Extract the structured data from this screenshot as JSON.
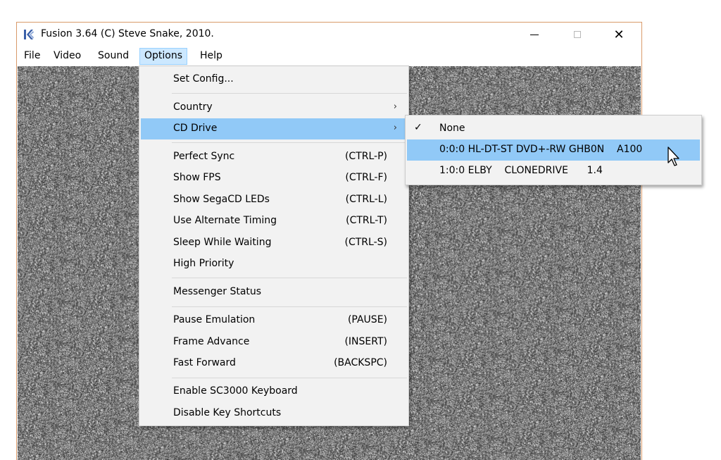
{
  "window": {
    "title": "Fusion 3.64 (C) Steve Snake, 2010.",
    "close_glyph": "✕"
  },
  "menubar": [
    "File",
    "Video",
    "Sound",
    "Options",
    "Help"
  ],
  "options_menu": {
    "set_config": "Set Config...",
    "country": "Country",
    "cd_drive": "CD Drive",
    "perfect_sync": {
      "label": "Perfect Sync",
      "shortcut": "(CTRL-P)"
    },
    "show_fps": {
      "label": "Show FPS",
      "shortcut": "(CTRL-F)"
    },
    "show_segacd_leds": {
      "label": "Show SegaCD LEDs",
      "shortcut": "(CTRL-L)"
    },
    "use_alternate_timing": {
      "label": "Use Alternate Timing",
      "shortcut": "(CTRL-T)"
    },
    "sleep_while_waiting": {
      "label": "Sleep While Waiting",
      "shortcut": "(CTRL-S)"
    },
    "high_priority": "High Priority",
    "messenger_status": "Messenger Status",
    "pause_emulation": {
      "label": "Pause Emulation",
      "shortcut": "(PAUSE)"
    },
    "frame_advance": {
      "label": "Frame Advance",
      "shortcut": "(INSERT)"
    },
    "fast_forward": {
      "label": "Fast Forward",
      "shortcut": "(BACKSPC)"
    },
    "enable_sc3000_keyboard": "Enable SC3000 Keyboard",
    "disable_key_shortcuts": "Disable Key Shortcuts",
    "submenu_arrow": "›"
  },
  "cd_drive_menu": {
    "check_glyph": "✓",
    "items": [
      "None",
      "0:0:0 HL-DT-ST DVD+-RW GHB0N    A100",
      "1:0:0 ELBY    CLONEDRIVE      1.4"
    ]
  },
  "colors": {
    "menu_bg": "#f2f2f2",
    "menu_highlight": "#91c9f7",
    "menubar_open": "#cce8ff",
    "window_border": "#d99a6a"
  }
}
